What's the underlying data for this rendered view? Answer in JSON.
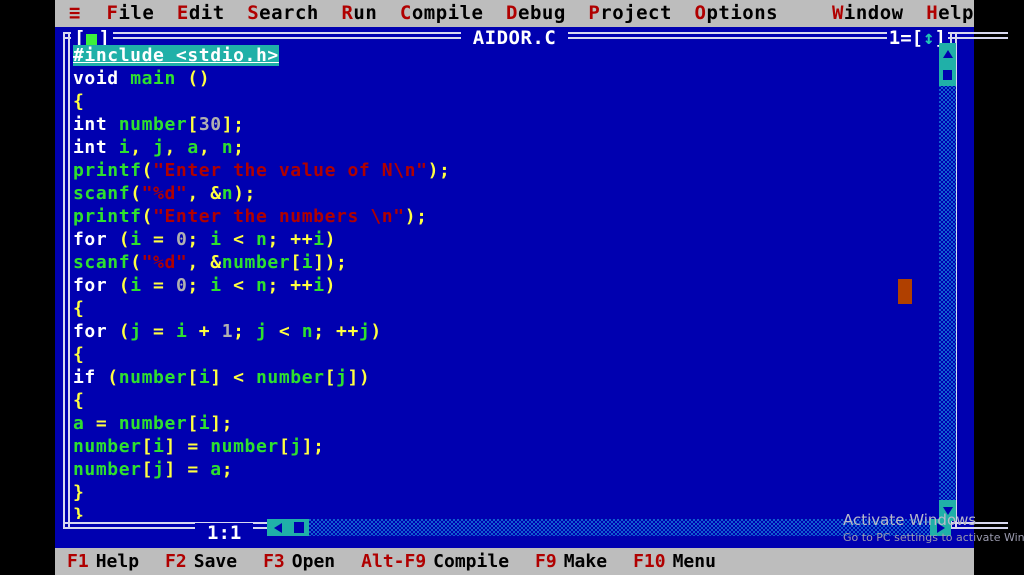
{
  "menubar": {
    "hamburger": "≡",
    "items": [
      {
        "hot": "F",
        "rest": "ile"
      },
      {
        "hot": "E",
        "rest": "dit"
      },
      {
        "hot": "S",
        "rest": "earch"
      },
      {
        "hot": "R",
        "rest": "un"
      },
      {
        "hot": "C",
        "rest": "ompile"
      },
      {
        "hot": "D",
        "rest": "ebug"
      },
      {
        "hot": "P",
        "rest": "roject"
      },
      {
        "hot": "O",
        "rest": "ptions"
      },
      {
        "hot": "W",
        "rest": "indow"
      },
      {
        "hot": "H",
        "rest": "elp"
      }
    ]
  },
  "window": {
    "title": "AIDOR.C",
    "number": "1",
    "close_left": "[",
    "close_right": "]",
    "zoom_glyph": "↕",
    "zoom_left": "=[",
    "zoom_right": "]",
    "cursor_position": "1:1"
  },
  "editor": {
    "lines": [
      {
        "selected": true,
        "tokens": [
          {
            "t": "#include <stdio.h>",
            "c": "sel"
          }
        ]
      },
      {
        "tokens": [
          {
            "t": "void",
            "c": "tok-key"
          },
          {
            "t": " ",
            "c": "tok-plain"
          },
          {
            "t": "main",
            "c": "tok-id"
          },
          {
            "t": " ",
            "c": "tok-plain"
          },
          {
            "t": "()",
            "c": "tok-punc"
          }
        ]
      },
      {
        "tokens": [
          {
            "t": "{",
            "c": "tok-punc"
          }
        ]
      },
      {
        "tokens": [
          {
            "t": "int",
            "c": "tok-key"
          },
          {
            "t": " ",
            "c": "tok-plain"
          },
          {
            "t": "number",
            "c": "tok-id"
          },
          {
            "t": "[",
            "c": "tok-punc"
          },
          {
            "t": "30",
            "c": "tok-num"
          },
          {
            "t": "];",
            "c": "tok-punc"
          }
        ]
      },
      {
        "tokens": [
          {
            "t": "int",
            "c": "tok-key"
          },
          {
            "t": " ",
            "c": "tok-plain"
          },
          {
            "t": "i",
            "c": "tok-id"
          },
          {
            "t": ", ",
            "c": "tok-punc"
          },
          {
            "t": "j",
            "c": "tok-id"
          },
          {
            "t": ", ",
            "c": "tok-punc"
          },
          {
            "t": "a",
            "c": "tok-id"
          },
          {
            "t": ", ",
            "c": "tok-punc"
          },
          {
            "t": "n",
            "c": "tok-id"
          },
          {
            "t": ";",
            "c": "tok-punc"
          }
        ]
      },
      {
        "tokens": [
          {
            "t": "printf",
            "c": "tok-id"
          },
          {
            "t": "(",
            "c": "tok-punc"
          },
          {
            "t": "\"Enter the value of N\\n\"",
            "c": "tok-str"
          },
          {
            "t": ");",
            "c": "tok-punc"
          }
        ]
      },
      {
        "tokens": [
          {
            "t": "scanf",
            "c": "tok-id"
          },
          {
            "t": "(",
            "c": "tok-punc"
          },
          {
            "t": "\"%d\"",
            "c": "tok-str"
          },
          {
            "t": ", &",
            "c": "tok-punc"
          },
          {
            "t": "n",
            "c": "tok-id"
          },
          {
            "t": ");",
            "c": "tok-punc"
          }
        ]
      },
      {
        "tokens": [
          {
            "t": "printf",
            "c": "tok-id"
          },
          {
            "t": "(",
            "c": "tok-punc"
          },
          {
            "t": "\"Enter the numbers \\n\"",
            "c": "tok-str"
          },
          {
            "t": ");",
            "c": "tok-punc"
          }
        ]
      },
      {
        "tokens": [
          {
            "t": "for",
            "c": "tok-key"
          },
          {
            "t": " (",
            "c": "tok-punc"
          },
          {
            "t": "i",
            "c": "tok-id"
          },
          {
            "t": " = ",
            "c": "tok-punc"
          },
          {
            "t": "0",
            "c": "tok-num"
          },
          {
            "t": "; ",
            "c": "tok-punc"
          },
          {
            "t": "i",
            "c": "tok-id"
          },
          {
            "t": " < ",
            "c": "tok-punc"
          },
          {
            "t": "n",
            "c": "tok-id"
          },
          {
            "t": "; ++",
            "c": "tok-punc"
          },
          {
            "t": "i",
            "c": "tok-id"
          },
          {
            "t": ")",
            "c": "tok-punc"
          }
        ]
      },
      {
        "tokens": [
          {
            "t": "scanf",
            "c": "tok-id"
          },
          {
            "t": "(",
            "c": "tok-punc"
          },
          {
            "t": "\"%d\"",
            "c": "tok-str"
          },
          {
            "t": ", &",
            "c": "tok-punc"
          },
          {
            "t": "number",
            "c": "tok-id"
          },
          {
            "t": "[",
            "c": "tok-punc"
          },
          {
            "t": "i",
            "c": "tok-id"
          },
          {
            "t": "]);",
            "c": "tok-punc"
          }
        ]
      },
      {
        "tokens": [
          {
            "t": "for",
            "c": "tok-key"
          },
          {
            "t": " (",
            "c": "tok-punc"
          },
          {
            "t": "i",
            "c": "tok-id"
          },
          {
            "t": " = ",
            "c": "tok-punc"
          },
          {
            "t": "0",
            "c": "tok-num"
          },
          {
            "t": "; ",
            "c": "tok-punc"
          },
          {
            "t": "i",
            "c": "tok-id"
          },
          {
            "t": " < ",
            "c": "tok-punc"
          },
          {
            "t": "n",
            "c": "tok-id"
          },
          {
            "t": "; ++",
            "c": "tok-punc"
          },
          {
            "t": "i",
            "c": "tok-id"
          },
          {
            "t": ")",
            "c": "tok-punc"
          }
        ]
      },
      {
        "tokens": [
          {
            "t": "{",
            "c": "tok-punc"
          }
        ]
      },
      {
        "tokens": [
          {
            "t": "for",
            "c": "tok-key"
          },
          {
            "t": " (",
            "c": "tok-punc"
          },
          {
            "t": "j",
            "c": "tok-id"
          },
          {
            "t": " = ",
            "c": "tok-punc"
          },
          {
            "t": "i",
            "c": "tok-id"
          },
          {
            "t": " + ",
            "c": "tok-punc"
          },
          {
            "t": "1",
            "c": "tok-num"
          },
          {
            "t": "; ",
            "c": "tok-punc"
          },
          {
            "t": "j",
            "c": "tok-id"
          },
          {
            "t": " < ",
            "c": "tok-punc"
          },
          {
            "t": "n",
            "c": "tok-id"
          },
          {
            "t": "; ++",
            "c": "tok-punc"
          },
          {
            "t": "j",
            "c": "tok-id"
          },
          {
            "t": ")",
            "c": "tok-punc"
          }
        ]
      },
      {
        "tokens": [
          {
            "t": "{",
            "c": "tok-punc"
          }
        ]
      },
      {
        "tokens": [
          {
            "t": "if",
            "c": "tok-key"
          },
          {
            "t": " (",
            "c": "tok-punc"
          },
          {
            "t": "number",
            "c": "tok-id"
          },
          {
            "t": "[",
            "c": "tok-punc"
          },
          {
            "t": "i",
            "c": "tok-id"
          },
          {
            "t": "]",
            "c": "tok-punc"
          },
          {
            "t": " < ",
            "c": "tok-punc"
          },
          {
            "t": "number",
            "c": "tok-id"
          },
          {
            "t": "[",
            "c": "tok-punc"
          },
          {
            "t": "j",
            "c": "tok-id"
          },
          {
            "t": "])",
            "c": "tok-punc"
          }
        ]
      },
      {
        "tokens": [
          {
            "t": "{",
            "c": "tok-punc"
          }
        ]
      },
      {
        "tokens": [
          {
            "t": "a",
            "c": "tok-id"
          },
          {
            "t": " = ",
            "c": "tok-punc"
          },
          {
            "t": "number",
            "c": "tok-id"
          },
          {
            "t": "[",
            "c": "tok-punc"
          },
          {
            "t": "i",
            "c": "tok-id"
          },
          {
            "t": "];",
            "c": "tok-punc"
          }
        ]
      },
      {
        "tokens": [
          {
            "t": "number",
            "c": "tok-id"
          },
          {
            "t": "[",
            "c": "tok-punc"
          },
          {
            "t": "i",
            "c": "tok-id"
          },
          {
            "t": "]",
            "c": "tok-punc"
          },
          {
            "t": " = ",
            "c": "tok-punc"
          },
          {
            "t": "number",
            "c": "tok-id"
          },
          {
            "t": "[",
            "c": "tok-punc"
          },
          {
            "t": "j",
            "c": "tok-id"
          },
          {
            "t": "];",
            "c": "tok-punc"
          }
        ]
      },
      {
        "tokens": [
          {
            "t": "number",
            "c": "tok-id"
          },
          {
            "t": "[",
            "c": "tok-punc"
          },
          {
            "t": "j",
            "c": "tok-id"
          },
          {
            "t": "]",
            "c": "tok-punc"
          },
          {
            "t": " = ",
            "c": "tok-punc"
          },
          {
            "t": "a",
            "c": "tok-id"
          },
          {
            "t": ";",
            "c": "tok-punc"
          }
        ]
      },
      {
        "tokens": [
          {
            "t": "}",
            "c": "tok-punc"
          }
        ]
      },
      {
        "tokens": [
          {
            "t": "}",
            "c": "tok-punc"
          }
        ]
      }
    ]
  },
  "watermark": {
    "title": "Activate Windows",
    "subtitle": "Go to PC settings to activate Windows."
  },
  "statusbar": {
    "items": [
      {
        "key": "F1",
        "label": "Help"
      },
      {
        "key": "F2",
        "label": "Save"
      },
      {
        "key": "F3",
        "label": "Open"
      },
      {
        "key": "Alt-F9",
        "label": "Compile"
      },
      {
        "key": "F9",
        "label": "Make"
      },
      {
        "key": "F10",
        "label": "Menu"
      }
    ]
  },
  "colors": {
    "menu_bar_bg": "#bdbdbd",
    "editor_bg": "#0000b0",
    "hotkey": "#b00000",
    "identifier": "#2ee02e",
    "punctuation": "#ffff40",
    "string": "#b00000",
    "number": "#b0b0b0",
    "selection": "#20b0a8",
    "scrollbar_accent": "#20b0a8",
    "cursor_block": "#b04000",
    "close_box_square": "#3cf03c"
  }
}
